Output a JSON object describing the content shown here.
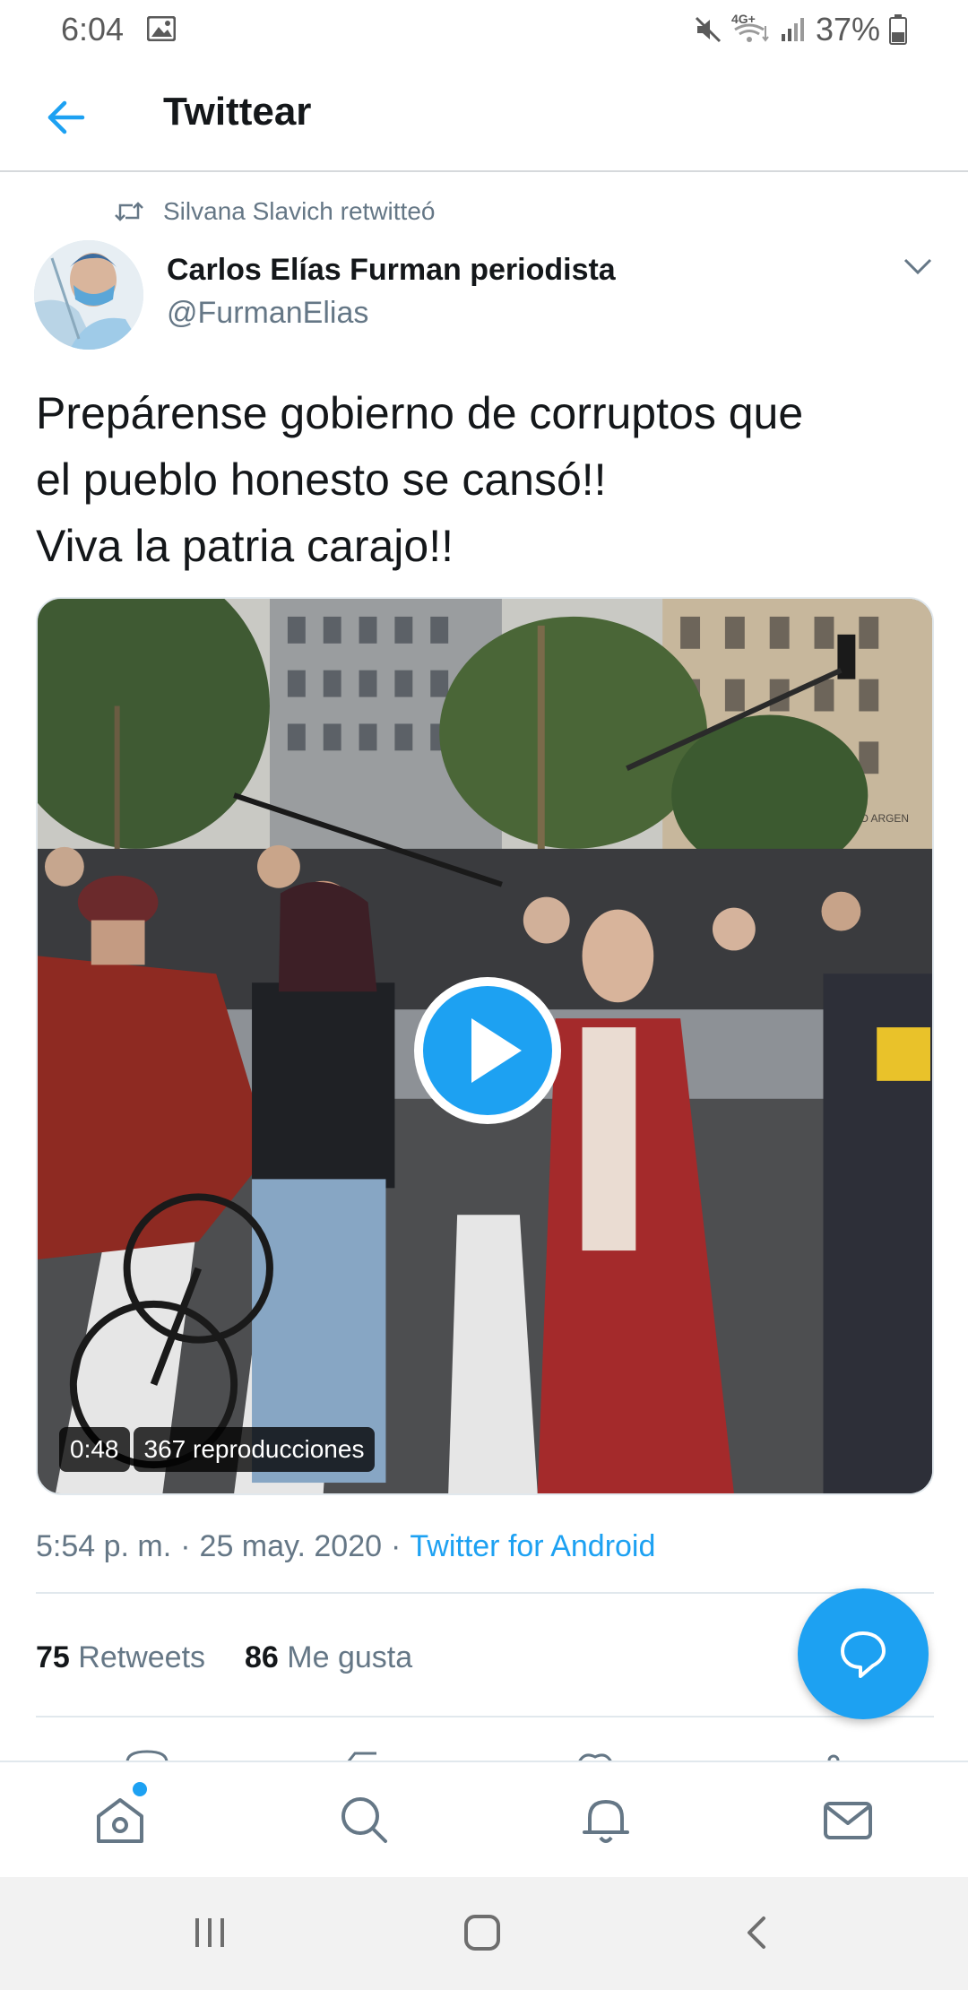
{
  "status_bar": {
    "time": "6:04",
    "network_label": "4G+",
    "battery": "37%",
    "icons": [
      "image-icon",
      "mute-icon",
      "network-icon",
      "signal-icon",
      "battery-icon"
    ]
  },
  "header": {
    "title": "Twittear",
    "back_icon": "arrow-left-icon"
  },
  "tweet": {
    "retweet_context": "Silvana Slavich retwitteó",
    "author_name": "Carlos Elías Furman periodista",
    "author_handle": "@FurmanElias",
    "text_lines": [
      "Prepárense gobierno de corruptos que",
      "el pueblo honesto se cansó!!",
      "Viva la patria carajo!!"
    ],
    "video": {
      "duration": "0:48",
      "views": "367 reproducciones",
      "overlay_text": "FRANCO ARGEN"
    },
    "meta": {
      "time": "5:54 p. m.",
      "separator": "·",
      "date": "25 may. 2020",
      "source": "Twitter for Android"
    },
    "stats": {
      "retweets_count": "75",
      "retweets_label": "Retweets",
      "likes_count": "86",
      "likes_label": "Me gusta"
    }
  },
  "colors": {
    "accent": "#1da1f2",
    "text_primary": "#14171a",
    "text_secondary": "#657786"
  },
  "tabbar": {
    "items": [
      "home-icon",
      "search-icon",
      "notifications-icon",
      "messages-icon"
    ]
  },
  "system_nav": {
    "items": [
      "recents-button",
      "home-button",
      "back-button"
    ]
  }
}
